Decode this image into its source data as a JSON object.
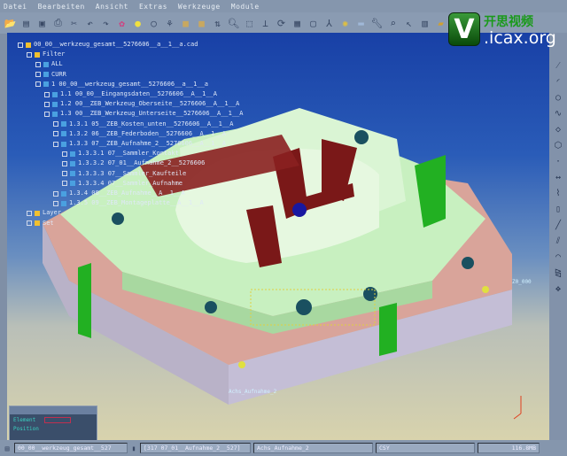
{
  "menu": [
    "Datei",
    "Bearbeiten",
    "Ansicht",
    "Extras",
    "Werkzeuge",
    "Module"
  ],
  "logo": {
    "cn": "开思视频",
    "domain": ".icax.org"
  },
  "tree": [
    {
      "level": 0,
      "label": "00_00__werkzeug_gesamt__5276606__a__1__a.cad"
    },
    {
      "level": 1,
      "label": "Filter"
    },
    {
      "level": 2,
      "label": "ALL"
    },
    {
      "level": 2,
      "label": "CURR"
    },
    {
      "level": 2,
      "label": "1 00_00__werkzeug_gesamt__5276606__a__1__a"
    },
    {
      "level": 3,
      "label": "1.1 00_00__Eingangsdaten__5276606__A__1__A"
    },
    {
      "level": 3,
      "label": "1.2 00__ZEB_Werkzeug_Oberseite__5276606__A__1__A"
    },
    {
      "level": 3,
      "label": "1.3 00__ZEB_Werkzeug_Unterseite__5276606__A__1__A"
    },
    {
      "level": 4,
      "label": "1.3.1 05__ZEB_Kosten_unten__5276606__A__1__A"
    },
    {
      "level": 4,
      "label": "1.3.2 06__ZEB_Federboden__5276606__A__1__A"
    },
    {
      "level": 4,
      "label": "1.3.3 07__ZEB_Aufnahme_2__5276606__A__1__A"
    },
    {
      "level": 5,
      "label": "1.3.3.1 07__Sammler_Kontakt"
    },
    {
      "level": 5,
      "label": "1.3.3.2 07_01__Aufnahme_2__5276606"
    },
    {
      "level": 5,
      "label": "1.3.3.3 07__Sammler_Kaufteile"
    },
    {
      "level": 5,
      "label": "1.3.3.4 07__Sammler_Aufnahme"
    },
    {
      "level": 4,
      "label": "1.3.4 08__ZEB_Aufnahme__A__1__A"
    },
    {
      "level": 4,
      "label": "1.3.5 09__ZEB_Montageplatte__A__1__A"
    },
    {
      "level": 1,
      "label": "Layer"
    },
    {
      "level": 1,
      "label": "Set"
    }
  ],
  "viewport_labels": [
    "Achs_Aufnahme_2",
    "Z0_000"
  ],
  "panel": {
    "element_label": "Element",
    "position_label": "Position",
    "element_value": ""
  },
  "status": {
    "file": "00_00__werkzeug_gesamt__527",
    "part": "[317 07_01__Aufnahme_2__527]",
    "feature": "Achs_Aufnahme_2",
    "cs": "CSY",
    "memory": "116.8MB"
  }
}
